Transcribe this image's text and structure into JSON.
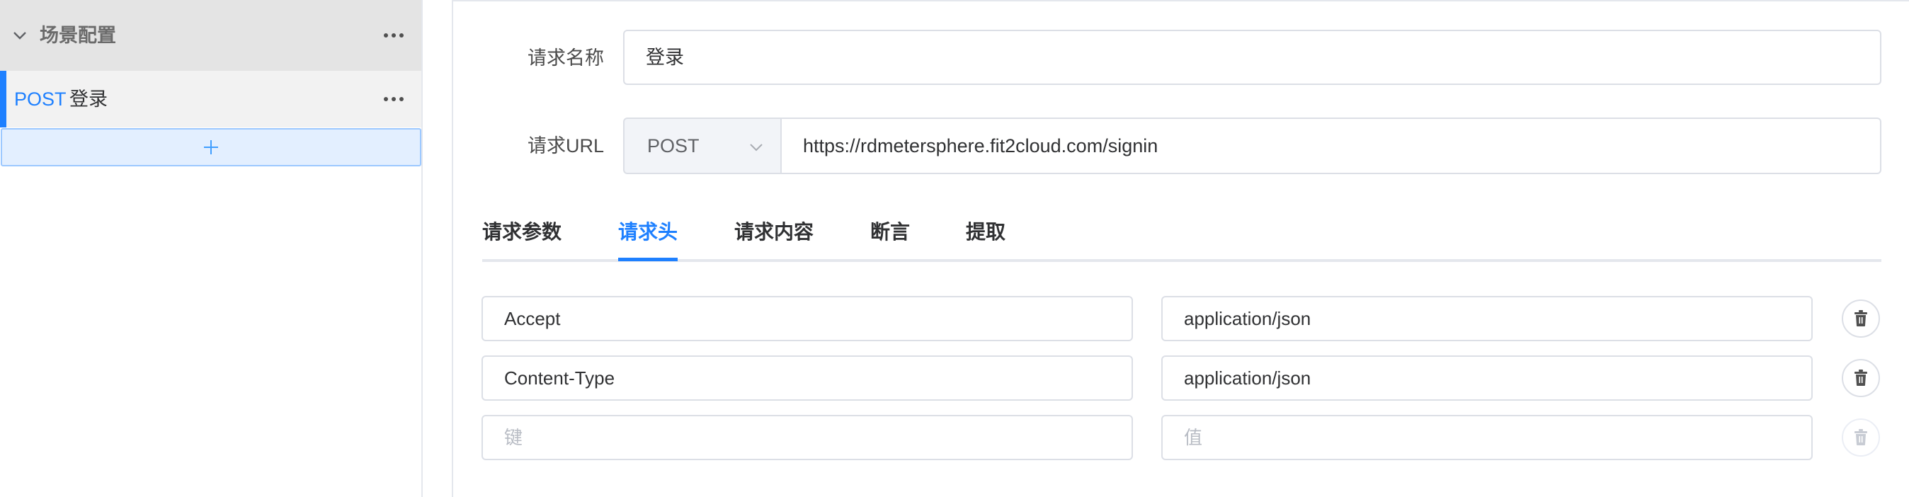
{
  "sidebar": {
    "scenario_title": "场景配置",
    "request": {
      "method": "POST",
      "name": "登录"
    }
  },
  "form": {
    "name_label": "请求名称",
    "name_value": "登录",
    "url_label": "请求URL",
    "method_value": "POST",
    "url_value": "https://rdmetersphere.fit2cloud.com/signin"
  },
  "tabs": [
    {
      "label": "请求参数",
      "active": false
    },
    {
      "label": "请求头",
      "active": true
    },
    {
      "label": "请求内容",
      "active": false
    },
    {
      "label": "断言",
      "active": false
    },
    {
      "label": "提取",
      "active": false
    }
  ],
  "headers": [
    {
      "key": "Accept",
      "value": "application/json"
    },
    {
      "key": "Content-Type",
      "value": "application/json"
    }
  ],
  "new_header": {
    "key_placeholder": "键",
    "value_placeholder": "值"
  },
  "colors": {
    "accent": "#1e80ff",
    "delete_icon": "#505050",
    "delete_icon_disabled": "#c8ccd4"
  },
  "icons": {
    "collapse": "chevron-down-icon",
    "more": "more-icon",
    "add": "plus-icon",
    "dropdown": "chevron-down-icon",
    "delete": "trash-icon"
  }
}
